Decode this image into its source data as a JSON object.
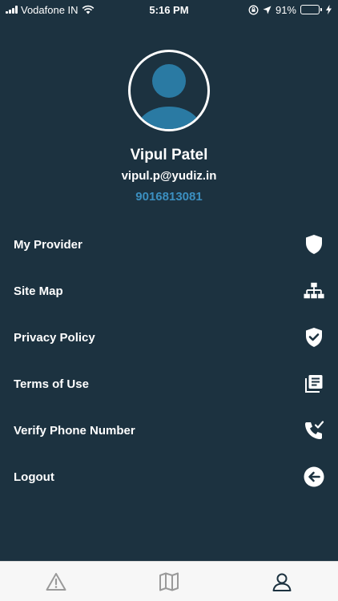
{
  "status_bar": {
    "carrier": "Vodafone IN",
    "time": "5:16 PM",
    "battery_percent": "91%",
    "battery_level": 0.91,
    "icons": [
      "signal-icon",
      "wifi-icon",
      "rotation-lock-icon",
      "location-arrow-icon",
      "battery-icon",
      "charging-bolt-icon"
    ]
  },
  "profile": {
    "name": "Vipul Patel",
    "email": "vipul.p@yudiz.in",
    "phone": "9016813081",
    "avatar_icon": "user-placeholder-icon"
  },
  "menu": {
    "items": [
      {
        "label": "My Provider",
        "icon": "shield-icon"
      },
      {
        "label": "Site Map",
        "icon": "sitemap-icon"
      },
      {
        "label": "Privacy Policy",
        "icon": "shield-check-icon"
      },
      {
        "label": "Terms of Use",
        "icon": "document-list-icon"
      },
      {
        "label": "Verify Phone Number",
        "icon": "phone-check-icon"
      },
      {
        "label": "Logout",
        "icon": "arrow-left-circle-icon"
      }
    ]
  },
  "tab_bar": {
    "tabs": [
      {
        "icon": "warning-icon",
        "active": false
      },
      {
        "icon": "map-icon",
        "active": false
      },
      {
        "icon": "profile-icon",
        "active": true
      }
    ]
  },
  "colors": {
    "background": "#1c3240",
    "accent": "#3b8fc0",
    "avatar_fill": "#2a7aa3",
    "tab_bar_bg": "#f7f7f7",
    "tab_active": "#1c3240",
    "tab_inactive": "#9a9a9a",
    "battery_green": "#4cd964"
  }
}
